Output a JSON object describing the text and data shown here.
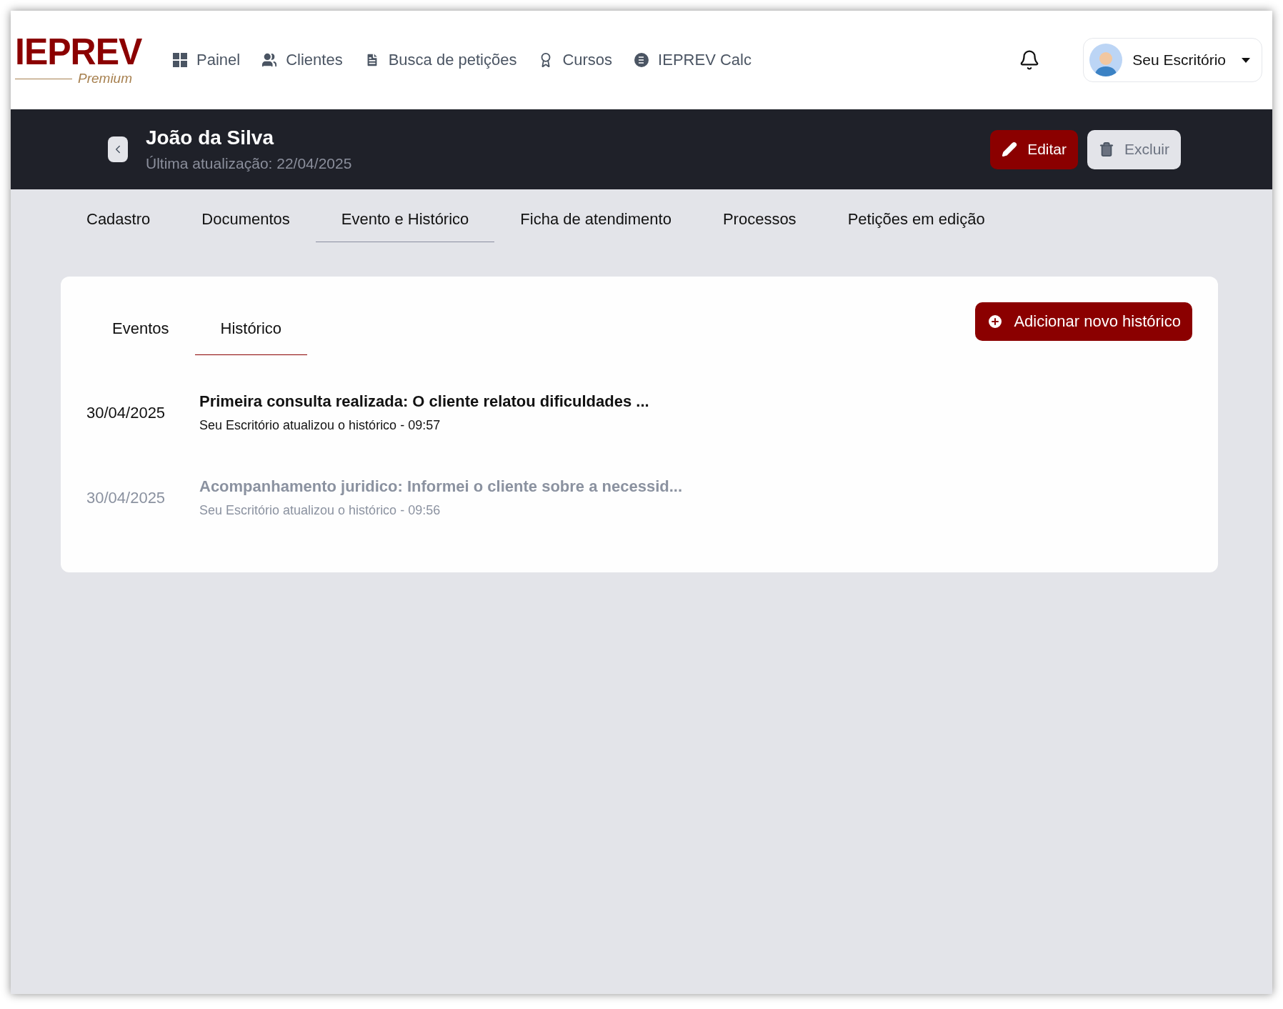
{
  "logo": {
    "name": "IEPREV",
    "tier": "Premium"
  },
  "nav": [
    {
      "label": "Painel",
      "kind": "grid"
    },
    {
      "label": "Clientes",
      "kind": "users"
    },
    {
      "label": "Busca de petições",
      "kind": "file"
    },
    {
      "label": "Cursos",
      "kind": "award"
    },
    {
      "label": "IEPREV Calc",
      "kind": "calc"
    }
  ],
  "account": {
    "name": "Seu Escritório"
  },
  "client": {
    "name": "João da Silva",
    "updated": "Última atualização: 22/04/2025"
  },
  "actions": [
    {
      "label": "Editar",
      "kind": "primary"
    },
    {
      "label": "Excluir",
      "kind": "secondary"
    }
  ],
  "tabs": [
    {
      "label": "Cadastro",
      "selected": false
    },
    {
      "label": "Documentos",
      "selected": false
    },
    {
      "label": "Evento e Histórico",
      "selected": true
    },
    {
      "label": "Ficha de atendimento",
      "selected": false
    },
    {
      "label": "Processos",
      "selected": false
    },
    {
      "label": "Petições em edição",
      "selected": false
    }
  ],
  "subtabs": [
    {
      "label": "Eventos",
      "selected": false
    },
    {
      "label": "Histórico",
      "selected": true
    }
  ],
  "add_button": "Adicionar novo histórico",
  "history": [
    {
      "date": "30/04/2025",
      "title": "Primeira consulta realizada: O cliente relatou dificuldades ...",
      "meta": "Seu Escritório atualizou o histórico - 09:57",
      "dimmed": false
    },
    {
      "date": "30/04/2025",
      "title": "Acompanhamento juridico: Informei o cliente sobre a necessid...",
      "meta": "Seu Escritório atualizou o histórico - 09:56",
      "dimmed": true
    }
  ]
}
